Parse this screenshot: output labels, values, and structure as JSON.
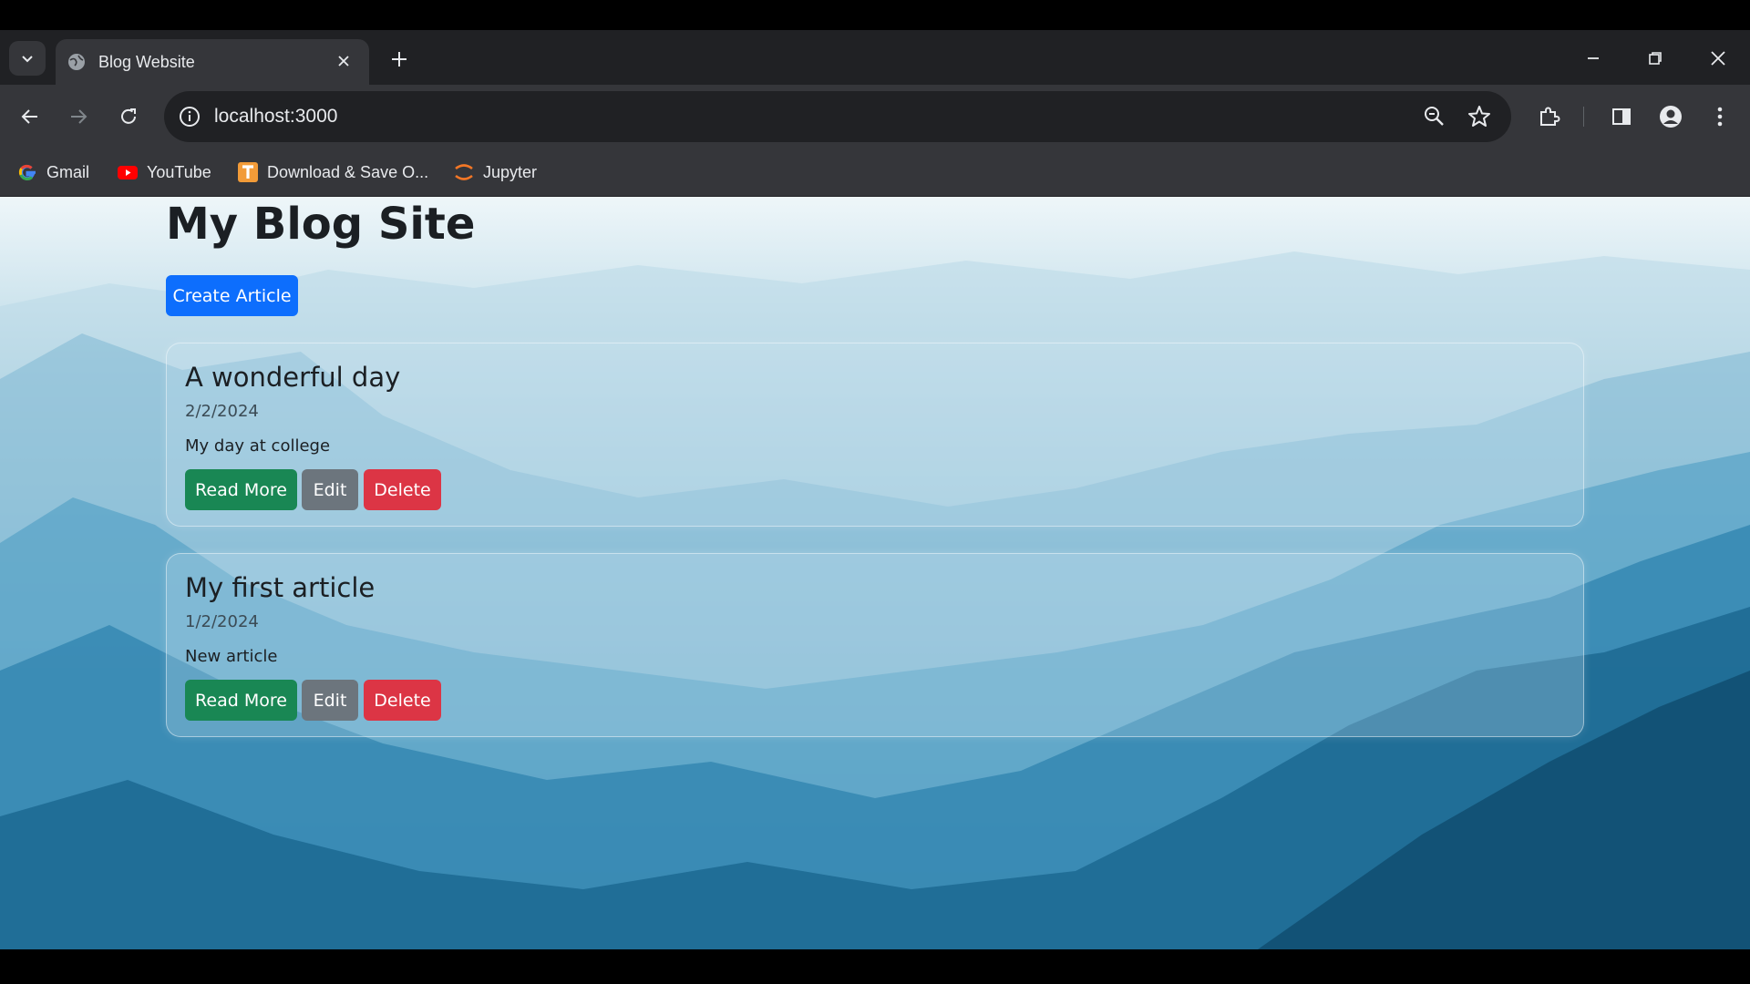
{
  "browser": {
    "tab_title": "Blog Website",
    "url": "localhost:3000",
    "bookmarks": [
      {
        "label": "Gmail",
        "icon": "google-icon"
      },
      {
        "label": "YouTube",
        "icon": "youtube-icon"
      },
      {
        "label": "Download & Save O...",
        "icon": "download-save-icon"
      },
      {
        "label": "Jupyter",
        "icon": "jupyter-icon"
      }
    ]
  },
  "page": {
    "title": "My Blog Site",
    "create_label": "Create Article",
    "articles": [
      {
        "title": "A wonderful day",
        "date": "2/2/2024",
        "description": "My day at college",
        "read_label": "Read More",
        "edit_label": "Edit",
        "delete_label": "Delete"
      },
      {
        "title": "My first article",
        "date": "1/2/2024",
        "description": "New article",
        "read_label": "Read More",
        "edit_label": "Edit",
        "delete_label": "Delete"
      }
    ]
  },
  "colors": {
    "primary": "#0d6efd",
    "success": "#198754",
    "secondary": "#6c757d",
    "danger": "#dc3545"
  }
}
